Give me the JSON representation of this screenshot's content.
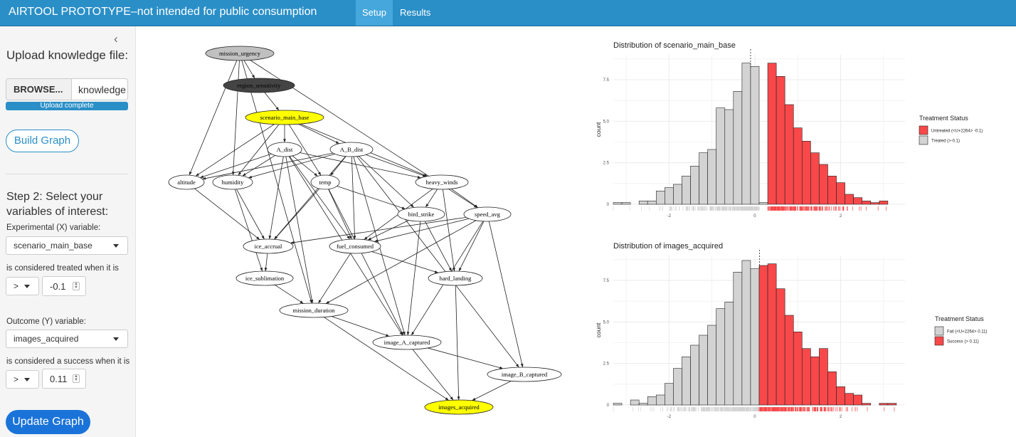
{
  "navbar": {
    "title": "AIRTOOL PROTOTYPE–not intended for public consumption",
    "tabs": [
      {
        "label": "Setup",
        "active": true
      },
      {
        "label": "Results",
        "active": false
      }
    ]
  },
  "sidebar": {
    "collapse_icon": "‹",
    "upload_label": "Upload knowledge file:",
    "browse_label": "BROWSE...",
    "file_name": "knowledge",
    "upload_status": "Upload complete",
    "build_button": "Build Graph",
    "step2_title": "Step 2: Select your variables of interest:",
    "x_label": "Experimental (X) variable:",
    "x_value": "scenario_main_base",
    "treated_label": "is considered treated when it is",
    "treated_op": ">",
    "treated_value": "-0.1",
    "y_label": "Outcome (Y) variable:",
    "y_value": "images_acquired",
    "success_label": "is considered a success when it is",
    "success_op": ">",
    "success_value": "0.11",
    "update_button": "Update Graph"
  },
  "graph": {
    "nodes": [
      {
        "id": "mission_urgency",
        "style": "gray"
      },
      {
        "id": "region_sensitivity",
        "style": "dark"
      },
      {
        "id": "scenario_main_base",
        "style": "yellow"
      },
      {
        "id": "A_dist",
        "style": "white"
      },
      {
        "id": "A_B_dist",
        "style": "white"
      },
      {
        "id": "altitude",
        "style": "white"
      },
      {
        "id": "humidity",
        "style": "white"
      },
      {
        "id": "temp",
        "style": "white"
      },
      {
        "id": "heavy_winds",
        "style": "white"
      },
      {
        "id": "bird_strike",
        "style": "white"
      },
      {
        "id": "speed_avg",
        "style": "white"
      },
      {
        "id": "ice_accrual",
        "style": "white"
      },
      {
        "id": "fuel_consumed",
        "style": "white"
      },
      {
        "id": "ice_sublimation",
        "style": "white"
      },
      {
        "id": "hard_landing",
        "style": "white"
      },
      {
        "id": "mission_duration",
        "style": "white"
      },
      {
        "id": "image_A_captured",
        "style": "white"
      },
      {
        "id": "image_B_captured",
        "style": "white"
      },
      {
        "id": "images_acquired",
        "style": "yellow"
      }
    ],
    "edges": [
      [
        "mission_urgency",
        "region_sensitivity"
      ],
      [
        "mission_urgency",
        "altitude"
      ],
      [
        "mission_urgency",
        "humidity"
      ],
      [
        "mission_urgency",
        "speed_avg"
      ],
      [
        "mission_urgency",
        "mission_duration"
      ],
      [
        "region_sensitivity",
        "scenario_main_base"
      ],
      [
        "scenario_main_base",
        "A_dist"
      ],
      [
        "scenario_main_base",
        "A_B_dist"
      ],
      [
        "scenario_main_base",
        "altitude"
      ],
      [
        "scenario_main_base",
        "humidity"
      ],
      [
        "scenario_main_base",
        "temp"
      ],
      [
        "scenario_main_base",
        "heavy_winds"
      ],
      [
        "A_dist",
        "altitude"
      ],
      [
        "A_dist",
        "humidity"
      ],
      [
        "A_dist",
        "temp"
      ],
      [
        "A_dist",
        "heavy_winds"
      ],
      [
        "A_dist",
        "fuel_consumed"
      ],
      [
        "A_dist",
        "ice_accrual"
      ],
      [
        "A_dist",
        "mission_duration"
      ],
      [
        "A_dist",
        "image_A_captured"
      ],
      [
        "A_B_dist",
        "altitude"
      ],
      [
        "A_B_dist",
        "humidity"
      ],
      [
        "A_B_dist",
        "temp"
      ],
      [
        "A_B_dist",
        "heavy_winds"
      ],
      [
        "A_B_dist",
        "bird_strike"
      ],
      [
        "A_B_dist",
        "fuel_consumed"
      ],
      [
        "A_B_dist",
        "image_B_captured"
      ],
      [
        "A_B_dist",
        "ice_accrual"
      ],
      [
        "altitude",
        "ice_accrual"
      ],
      [
        "humidity",
        "ice_accrual"
      ],
      [
        "humidity",
        "ice_sublimation"
      ],
      [
        "temp",
        "ice_accrual"
      ],
      [
        "temp",
        "fuel_consumed"
      ],
      [
        "temp",
        "bird_strike"
      ],
      [
        "heavy_winds",
        "bird_strike"
      ],
      [
        "heavy_winds",
        "fuel_consumed"
      ],
      [
        "heavy_winds",
        "speed_avg"
      ],
      [
        "heavy_winds",
        "hard_landing"
      ],
      [
        "bird_strike",
        "hard_landing"
      ],
      [
        "bird_strike",
        "fuel_consumed"
      ],
      [
        "bird_strike",
        "image_A_captured"
      ],
      [
        "speed_avg",
        "fuel_consumed"
      ],
      [
        "speed_avg",
        "ice_accrual"
      ],
      [
        "speed_avg",
        "hard_landing"
      ],
      [
        "speed_avg",
        "mission_duration"
      ],
      [
        "speed_avg",
        "image_A_captured"
      ],
      [
        "speed_avg",
        "image_B_captured"
      ],
      [
        "ice_accrual",
        "ice_sublimation"
      ],
      [
        "ice_sublimation",
        "mission_duration"
      ],
      [
        "fuel_consumed",
        "mission_duration"
      ],
      [
        "fuel_consumed",
        "hard_landing"
      ],
      [
        "hard_landing",
        "images_acquired"
      ],
      [
        "mission_duration",
        "image_A_captured"
      ],
      [
        "mission_duration",
        "images_acquired"
      ],
      [
        "image_A_captured",
        "image_B_captured"
      ],
      [
        "image_A_captured",
        "images_acquired"
      ],
      [
        "image_B_captured",
        "images_acquired"
      ],
      [
        "A_B_dist",
        "image_A_captured"
      ],
      [
        "temp",
        "image_A_captured"
      ]
    ]
  },
  "colors": {
    "treated_gray": "#d3d3d3",
    "untreated_red": "#f8484a",
    "navbar": "#2a8fc7",
    "accent": "#1a73d8"
  },
  "chart_data": [
    {
      "type": "bar",
      "title": "Distribution of  scenario_main_base",
      "xlabel": "",
      "ylabel": "count",
      "xlim": [
        -3.3,
        3.5
      ],
      "ylim": [
        0,
        90
      ],
      "xticks": [
        -2,
        0,
        2
      ],
      "xtick_labels": [
        "-2",
        "0",
        "2"
      ],
      "yticks": [
        0,
        25,
        50,
        75
      ],
      "ytick_labels": [
        "0",
        "2.5",
        "5.0",
        "7.5"
      ],
      "threshold": -0.1,
      "legend_title": "Treatment Status",
      "legend": [
        {
          "name": "Untreated (<U+2264> -0.1)",
          "color": "#f8484a"
        },
        {
          "name": "Treated (>-0.1)",
          "color": "#d3d3d3"
        }
      ],
      "bin_width": 0.2,
      "bin_starts": [
        -3.3,
        -3.1,
        -2.9,
        -2.7,
        -2.5,
        -2.3,
        -2.1,
        -1.9,
        -1.7,
        -1.5,
        -1.3,
        -1.1,
        -0.9,
        -0.7,
        -0.5,
        -0.3,
        -0.1,
        0.1,
        0.3,
        0.5,
        0.7,
        0.9,
        1.1,
        1.3,
        1.5,
        1.7,
        1.9,
        2.1,
        2.3,
        2.5,
        2.7,
        2.9
      ],
      "values": [
        1,
        1,
        0,
        2,
        2,
        8,
        10,
        12,
        17,
        23,
        31,
        33,
        58,
        57,
        68,
        85,
        83,
        1,
        85,
        77,
        60,
        46,
        38,
        31,
        24,
        17,
        13,
        6,
        4,
        2,
        1,
        2
      ],
      "bar_groups": [
        "gray",
        "gray",
        "gray",
        "gray",
        "gray",
        "gray",
        "gray",
        "gray",
        "gray",
        "gray",
        "gray",
        "gray",
        "gray",
        "gray",
        "gray",
        "gray",
        "gray",
        "gray",
        "red",
        "red",
        "red",
        "red",
        "red",
        "red",
        "red",
        "red",
        "red",
        "red",
        "red",
        "red",
        "red",
        "red"
      ]
    },
    {
      "type": "bar",
      "title": "Distribution of  images_acquired",
      "xlabel": "",
      "ylabel": "count",
      "xlim": [
        -3.3,
        3.5
      ],
      "ylim": [
        0,
        90
      ],
      "xticks": [
        -2,
        0,
        2
      ],
      "xtick_labels": [
        "-2",
        "0",
        "2"
      ],
      "yticks": [
        0,
        25,
        50,
        75
      ],
      "ytick_labels": [
        "0",
        "2.5",
        "5.0",
        "7.5"
      ],
      "threshold": 0.11,
      "legend_title": "Treatment Status",
      "legend": [
        {
          "name": "Fail (<U+2264> 0.11)",
          "color": "#d3d3d3"
        },
        {
          "name": "Success (> 0.11)",
          "color": "#f8484a"
        }
      ],
      "bin_width": 0.2,
      "bin_starts": [
        -3.3,
        -3.1,
        -2.9,
        -2.7,
        -2.5,
        -2.3,
        -2.1,
        -1.9,
        -1.7,
        -1.5,
        -1.3,
        -1.1,
        -0.9,
        -0.7,
        -0.5,
        -0.3,
        -0.1,
        0.1,
        0.3,
        0.5,
        0.7,
        0.9,
        1.1,
        1.3,
        1.5,
        1.7,
        1.9,
        2.1,
        2.3,
        2.5,
        2.7,
        2.9,
        3.1
      ],
      "values": [
        1,
        0,
        3,
        1,
        5,
        6,
        13,
        22,
        29,
        36,
        42,
        48,
        58,
        62,
        80,
        87,
        82,
        84,
        85,
        70,
        54,
        44,
        34,
        29,
        34,
        20,
        11,
        7,
        6,
        1,
        0,
        1,
        1
      ],
      "bar_groups": [
        "gray",
        "gray",
        "gray",
        "gray",
        "gray",
        "gray",
        "gray",
        "gray",
        "gray",
        "gray",
        "gray",
        "gray",
        "gray",
        "gray",
        "gray",
        "gray",
        "gray",
        "red",
        "red",
        "red",
        "red",
        "red",
        "red",
        "red",
        "red",
        "red",
        "red",
        "red",
        "red",
        "red",
        "red",
        "red",
        "red"
      ]
    }
  ]
}
